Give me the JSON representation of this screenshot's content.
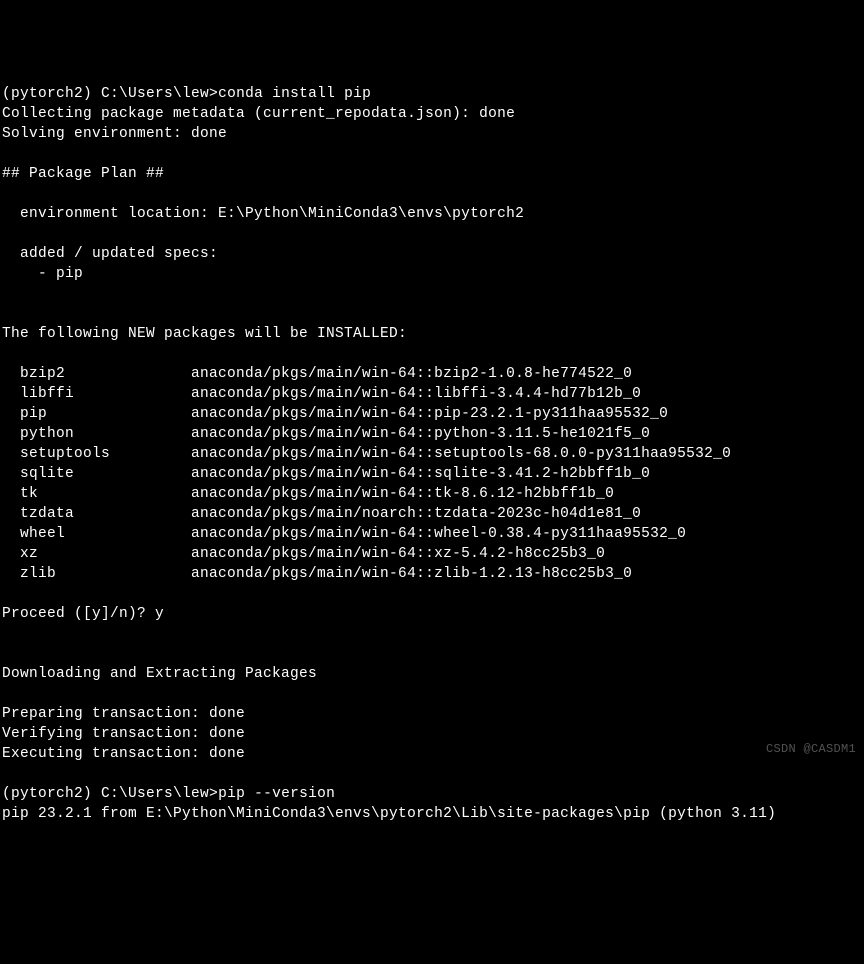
{
  "prompt1": {
    "env": "(pytorch2)",
    "path": "C:\\Users\\lew>",
    "command": "conda install pip"
  },
  "collecting": "Collecting package metadata (current_repodata.json): done",
  "solving": "Solving environment: done",
  "plan_header": "## Package Plan ##",
  "env_location": "  environment location: E:\\Python\\MiniConda3\\envs\\pytorch2",
  "added_specs": "  added / updated specs:",
  "spec_pip": "    - pip",
  "new_packages_header": "The following NEW packages will be INSTALLED:",
  "packages": [
    {
      "name": "bzip2",
      "spec": "anaconda/pkgs/main/win-64::bzip2-1.0.8-he774522_0"
    },
    {
      "name": "libffi",
      "spec": "anaconda/pkgs/main/win-64::libffi-3.4.4-hd77b12b_0"
    },
    {
      "name": "pip",
      "spec": "anaconda/pkgs/main/win-64::pip-23.2.1-py311haa95532_0"
    },
    {
      "name": "python",
      "spec": "anaconda/pkgs/main/win-64::python-3.11.5-he1021f5_0"
    },
    {
      "name": "setuptools",
      "spec": "anaconda/pkgs/main/win-64::setuptools-68.0.0-py311haa95532_0"
    },
    {
      "name": "sqlite",
      "spec": "anaconda/pkgs/main/win-64::sqlite-3.41.2-h2bbff1b_0"
    },
    {
      "name": "tk",
      "spec": "anaconda/pkgs/main/win-64::tk-8.6.12-h2bbff1b_0"
    },
    {
      "name": "tzdata",
      "spec": "anaconda/pkgs/main/noarch::tzdata-2023c-h04d1e81_0"
    },
    {
      "name": "wheel",
      "spec": "anaconda/pkgs/main/win-64::wheel-0.38.4-py311haa95532_0"
    },
    {
      "name": "xz",
      "spec": "anaconda/pkgs/main/win-64::xz-5.4.2-h8cc25b3_0"
    },
    {
      "name": "zlib",
      "spec": "anaconda/pkgs/main/win-64::zlib-1.2.13-h8cc25b3_0"
    }
  ],
  "proceed_prompt": "Proceed ([y]/n)? ",
  "proceed_answer": "y",
  "downloading": "Downloading and Extracting Packages",
  "preparing": "Preparing transaction: done",
  "verifying": "Verifying transaction: done",
  "executing": "Executing transaction: done",
  "prompt2": {
    "env": "(pytorch2)",
    "path": "C:\\Users\\lew>",
    "command": "pip --version"
  },
  "pip_version_output": "pip 23.2.1 from E:\\Python\\MiniConda3\\envs\\pytorch2\\Lib\\site-packages\\pip (python 3.11)",
  "watermark": "CSDN @CASDM1"
}
